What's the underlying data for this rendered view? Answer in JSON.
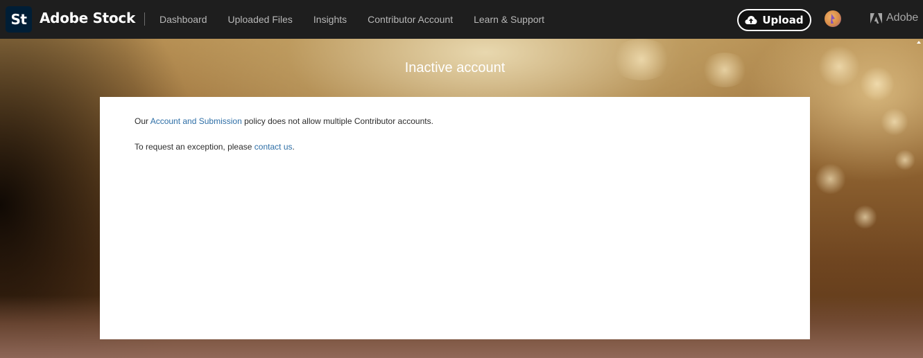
{
  "brand": {
    "logo_text": "St",
    "name": "Adobe Stock"
  },
  "nav": {
    "items": [
      {
        "label": "Dashboard"
      },
      {
        "label": "Uploaded Files"
      },
      {
        "label": "Insights"
      },
      {
        "label": "Contributor Account"
      },
      {
        "label": "Learn & Support"
      }
    ]
  },
  "header_actions": {
    "upload_label": "Upload",
    "adobe_label": "Adobe"
  },
  "hero": {
    "title": "Inactive account"
  },
  "card": {
    "line1_prefix": "Our",
    "line1_link": "Account and Submission",
    "line1_suffix": "policy does not allow multiple Contributor accounts.",
    "line2_prefix": "To request an exception, please",
    "line2_link": "contact us",
    "line2_suffix": "."
  },
  "colors": {
    "topbar": "#1e1e1e",
    "logo_tile": "#001e36",
    "link": "#2d6ea6"
  }
}
